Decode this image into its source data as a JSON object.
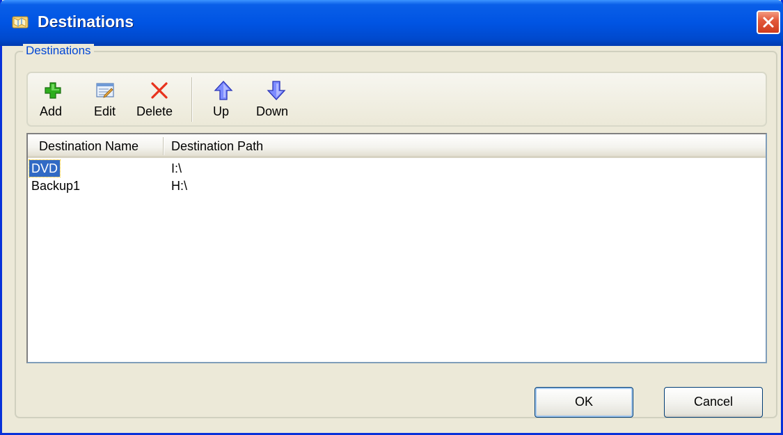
{
  "window": {
    "title": "Destinations",
    "title_icon": "folder-map-icon"
  },
  "group": {
    "legend": "Destinations"
  },
  "toolbar": {
    "add_label": "Add",
    "edit_label": "Edit",
    "delete_label": "Delete",
    "up_label": "Up",
    "down_label": "Down"
  },
  "list": {
    "columns": [
      "Destination Name",
      "Destination Path"
    ],
    "rows": [
      {
        "name": "DVD",
        "path": "I:\\",
        "selected": true
      },
      {
        "name": "Backup1",
        "path": "H:\\",
        "selected": false
      }
    ]
  },
  "buttons": {
    "ok_label": "OK",
    "cancel_label": "Cancel"
  },
  "colors": {
    "titlebar": "#0054e3",
    "accent_text": "#0046d5",
    "selection": "#316ac5",
    "close_button": "#e35a3c"
  }
}
